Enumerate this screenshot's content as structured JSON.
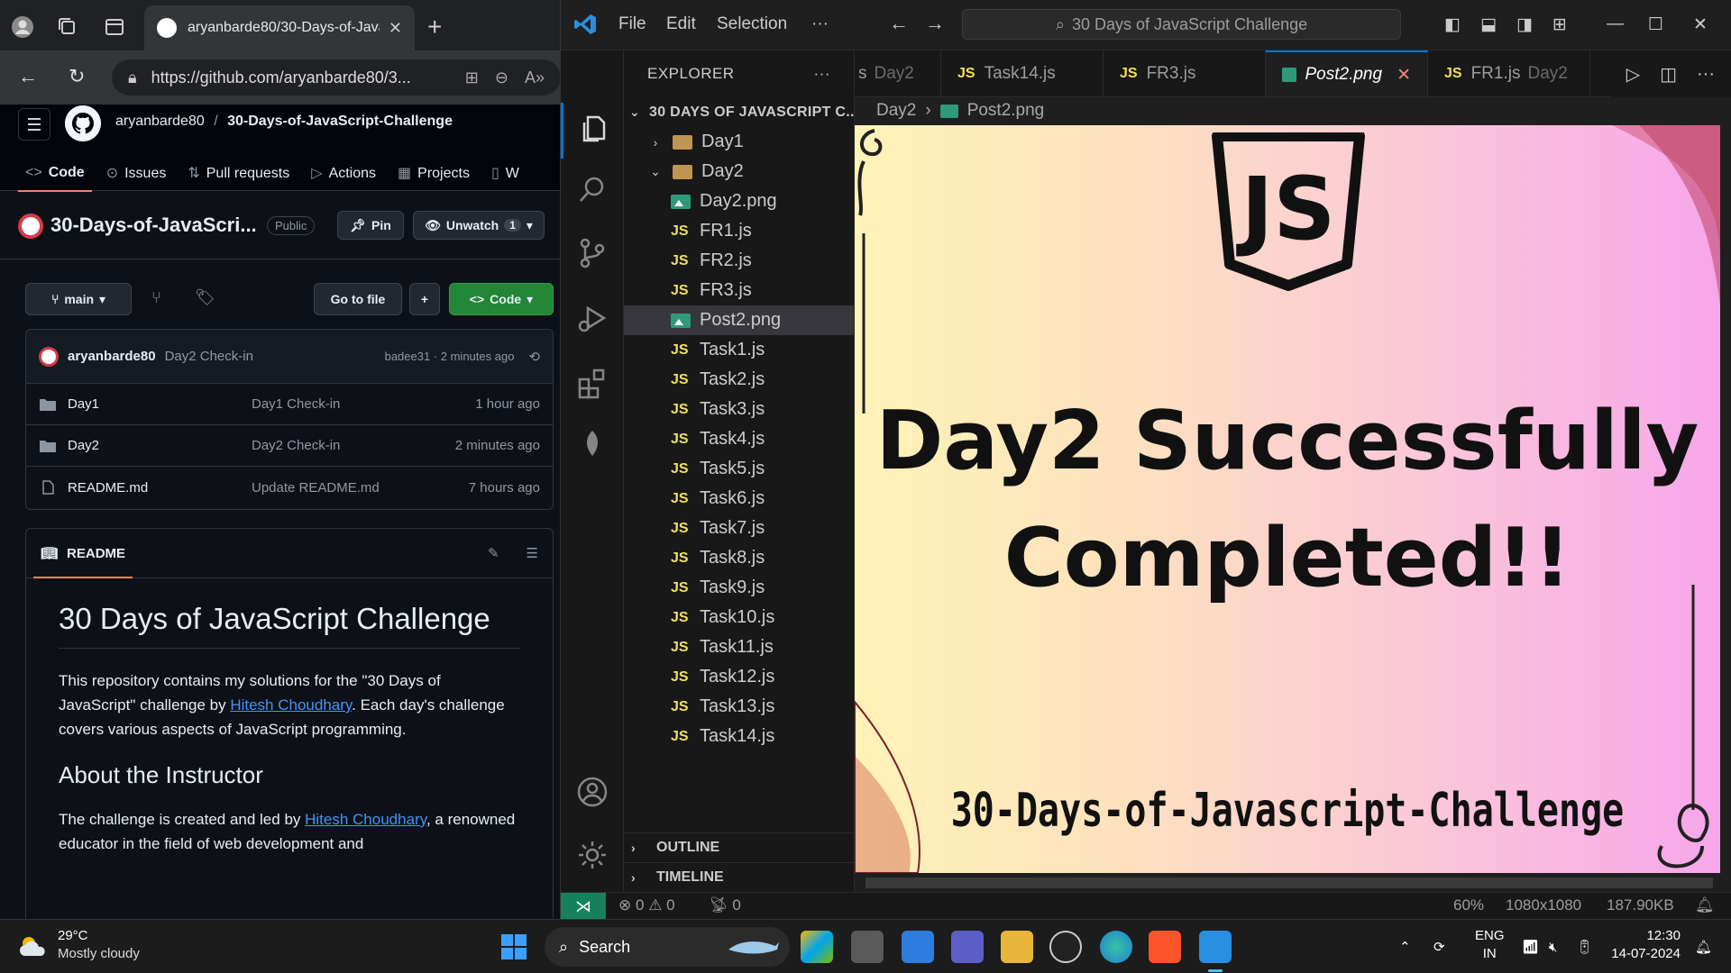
{
  "browser": {
    "tab_title": "aryanbarde80/30-Days-of-JavaSc",
    "url": "https://github.com/aryanbarde80/3...",
    "github": {
      "owner": "aryanbarde80",
      "separator": "/",
      "repo": "30-Days-of-JavaScript-Challenge",
      "nav": [
        "Code",
        "Issues",
        "Pull requests",
        "Actions",
        "Projects",
        "W"
      ],
      "repo_title": "30-Days-of-JavaScri...",
      "visibility": "Public",
      "pin_label": "Pin",
      "unwatch_label": "Unwatch",
      "watch_count": "1",
      "branch": "main",
      "go_to_file": "Go to file",
      "code_btn": "Code",
      "commit": {
        "author": "aryanbarde80",
        "message": "Day2 Check-in",
        "meta": "badee31 · 2 minutes ago"
      },
      "files": [
        {
          "name": "Day1",
          "message": "Day1 Check-in",
          "time": "1 hour ago",
          "type": "folder"
        },
        {
          "name": "Day2",
          "message": "Day2 Check-in",
          "time": "2 minutes ago",
          "type": "folder"
        },
        {
          "name": "README.md",
          "message": "Update README.md",
          "time": "7 hours ago",
          "type": "file"
        }
      ],
      "readme": {
        "tab": "README",
        "h1": "30 Days of JavaScript Challenge",
        "p1a": "This repository contains my solutions for the \"30 Days of JavaScript\" challenge by ",
        "link": "Hitesh Choudhary",
        "p1b": ". Each day's challenge covers various aspects of JavaScript programming.",
        "h2": "About the Instructor",
        "p2a": "The challenge is created and led by ",
        "p2b": ", a renowned educator in the field of web development and"
      }
    }
  },
  "vscode": {
    "menu": [
      "File",
      "Edit",
      "Selection",
      "···"
    ],
    "search": "30 Days of JavaScript Challenge",
    "explorer_label": "EXPLORER",
    "root": "30 DAYS OF JAVASCRIPT C...",
    "tree": [
      {
        "label": "Day1",
        "kind": "folder-closed"
      },
      {
        "label": "Day2",
        "kind": "folder-open"
      },
      {
        "label": "Day2.png",
        "kind": "img"
      },
      {
        "label": "FR1.js",
        "kind": "js"
      },
      {
        "label": "FR2.js",
        "kind": "js"
      },
      {
        "label": "FR3.js",
        "kind": "js"
      },
      {
        "label": "Post2.png",
        "kind": "img",
        "selected": true
      },
      {
        "label": "Task1.js",
        "kind": "js"
      },
      {
        "label": "Task2.js",
        "kind": "js"
      },
      {
        "label": "Task3.js",
        "kind": "js"
      },
      {
        "label": "Task4.js",
        "kind": "js"
      },
      {
        "label": "Task5.js",
        "kind": "js"
      },
      {
        "label": "Task6.js",
        "kind": "js"
      },
      {
        "label": "Task7.js",
        "kind": "js"
      },
      {
        "label": "Task8.js",
        "kind": "js"
      },
      {
        "label": "Task9.js",
        "kind": "js"
      },
      {
        "label": "Task10.js",
        "kind": "js"
      },
      {
        "label": "Task11.js",
        "kind": "js"
      },
      {
        "label": "Task12.js",
        "kind": "js"
      },
      {
        "label": "Task13.js",
        "kind": "js"
      },
      {
        "label": "Task14.js",
        "kind": "js"
      }
    ],
    "outline": "OUTLINE",
    "timeline": "TIMELINE",
    "tabs": [
      {
        "label": "s",
        "dim": "Day2",
        "kind": "none"
      },
      {
        "label": "Task14.js",
        "dim": "",
        "kind": "js"
      },
      {
        "label": "FR3.js",
        "dim": "",
        "kind": "js"
      },
      {
        "label": "Post2.png",
        "dim": "",
        "kind": "img",
        "active": true
      },
      {
        "label": "FR1.js",
        "dim": "Day2",
        "kind": "js"
      }
    ],
    "breadcrumb": [
      "Day2",
      "Post2.png"
    ],
    "preview": {
      "logo_text": "JS",
      "line1": "Day2 Successfully",
      "line2": "Completed!!",
      "sub": "30-Days-of-Javascript-Challenge"
    },
    "status": {
      "errors": "0",
      "warnings": "0",
      "ports": "0",
      "zoom": "60%",
      "dims": "1080x1080",
      "size": "187.90KB"
    }
  },
  "taskbar": {
    "temp": "29°C",
    "weather": "Mostly cloudy",
    "search": "Search",
    "lang1": "ENG",
    "lang2": "IN",
    "time": "12:30",
    "date": "14-07-2024"
  }
}
